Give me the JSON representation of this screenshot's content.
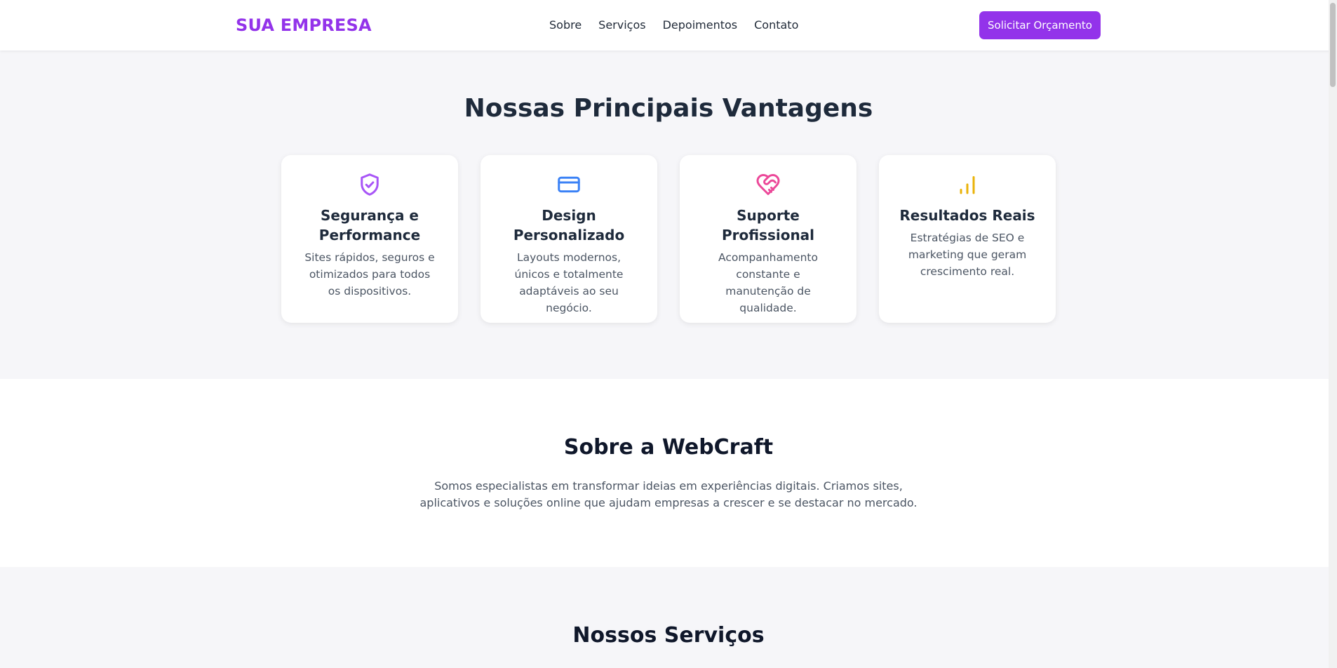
{
  "header": {
    "logo": "SUA EMPRESA",
    "nav": [
      "Sobre",
      "Serviços",
      "Depoimentos",
      "Contato"
    ],
    "cta_label": "Solicitar Orçamento"
  },
  "advantages": {
    "title": "Nossas Principais Vantagens",
    "cards": [
      {
        "icon": "shield-check-icon",
        "color": "#a855f7",
        "title": "Segurança e Performance",
        "desc": "Sites rápidos, seguros e otimizados para todos os dispositivos."
      },
      {
        "icon": "credit-card-icon",
        "color": "#3b82f6",
        "title": "Design Personalizado",
        "desc": "Layouts modernos, únicos e totalmente adaptáveis ao seu negócio."
      },
      {
        "icon": "heart-handshake-icon",
        "color": "#ec4899",
        "title": "Suporte Profissional",
        "desc": "Acompanhamento constante e manutenção de qualidade."
      },
      {
        "icon": "bar-chart-icon",
        "color": "#eab308",
        "title": "Resultados Reais",
        "desc": "Estratégias de SEO e marketing que geram crescimento real."
      }
    ]
  },
  "about": {
    "title": "Sobre a WebCraft",
    "text": "Somos especialistas em transformar ideias em experiências digitais. Criamos sites, aplicativos e soluções online que ajudam empresas a crescer e se destacar no mercado."
  },
  "services": {
    "title": "Nossos Serviços"
  },
  "colors": {
    "brand": "#9333ea",
    "heading": "#1e2a3b",
    "muted": "#4b5563",
    "section_bg": "#f6f6f9"
  }
}
